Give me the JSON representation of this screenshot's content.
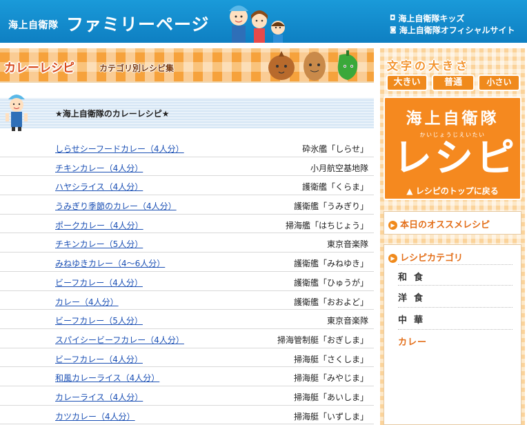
{
  "header": {
    "brand_small": "海上自衛隊",
    "brand_large": "ファミリーページ",
    "links": [
      {
        "label": "海上自衛隊キッズ"
      },
      {
        "label": "海上自衛隊オフィシャルサイト"
      }
    ]
  },
  "category_banner": {
    "title": "カレーレシピ",
    "subtitle": "カテゴリ別レシピ集"
  },
  "section": {
    "title": "★海上自衛隊のカレーレシピ★"
  },
  "recipes": [
    {
      "name": "しらせシーフードカレー（4人分）",
      "source": "砕氷艦「しらせ」"
    },
    {
      "name": "チキンカレー（4人分）",
      "source": "小月航空基地隊"
    },
    {
      "name": "ハヤシライス（4人分）",
      "source": "護衛艦「くらま」"
    },
    {
      "name": "うみぎり季節のカレー（4人分）",
      "source": "護衛艦「うみぎり」"
    },
    {
      "name": "ポークカレー（4人分）",
      "source": "掃海艦「はちじょう」"
    },
    {
      "name": "チキンカレー（5人分）",
      "source": "東京音楽隊"
    },
    {
      "name": "みねゆきカレー（4〜6人分）",
      "source": "護衛艦「みねゆき」"
    },
    {
      "name": "ビーフカレー（4人分）",
      "source": "護衛艦「ひゅうが」"
    },
    {
      "name": "カレー（4人分）",
      "source": "護衛艦「おおよど」"
    },
    {
      "name": "ビーフカレー（5人分）",
      "source": "東京音楽隊"
    },
    {
      "name": "スパイシービーフカレー（4人分）",
      "source": "掃海管制艇「おぎしま」"
    },
    {
      "name": "ビーフカレー（4人分）",
      "source": "掃海艇「さくしま」"
    },
    {
      "name": "和風カレーライス（4人分）",
      "source": "掃海艇「みやじま」"
    },
    {
      "name": "カレーライス（4人分）",
      "source": "掃海艇「あいしま」"
    },
    {
      "name": "カツカレー（4人分）",
      "source": "掃海艇「いずしま」"
    }
  ],
  "sidebar": {
    "font_size_label": "文字の大きさ",
    "font_buttons": {
      "large": "大きい",
      "normal": "普通",
      "small": "小さい"
    },
    "recipe_box": {
      "title": "海上自衛隊",
      "ruby": "かいじょうじえいたい",
      "big": "レシピ",
      "back": "▲ レシピのトップに戻る"
    },
    "recommend_title": "本日のオススメレシピ",
    "category_title": "レシピカテゴリ",
    "categories": [
      "和食",
      "洋食",
      "中華",
      "カレー"
    ]
  },
  "colors": {
    "header_blue": "#1a9ad9",
    "accent_orange": "#f08a1c",
    "link_blue": "#1a4fb4"
  }
}
